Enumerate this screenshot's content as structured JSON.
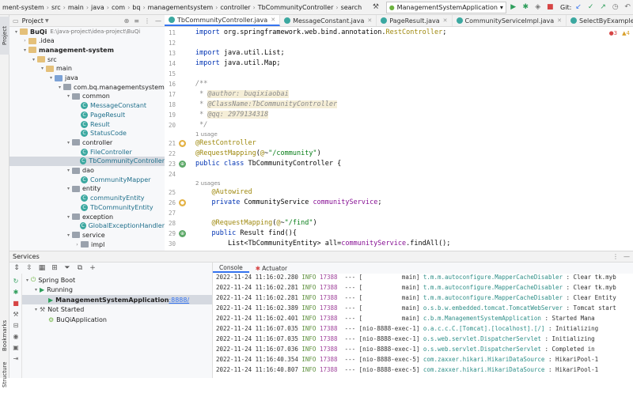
{
  "breadcrumb": [
    "ment-system",
    "src",
    "main",
    "java",
    "com",
    "bq",
    "managementsystem",
    "controller",
    "TbCommunityController",
    "search"
  ],
  "run_config": "ManagementSystemApplication",
  "git_label": "Git:",
  "project_panel": {
    "title": "Project"
  },
  "tree": [
    {
      "indent": 0,
      "arrow": "▾",
      "icon": "folder",
      "label": "BuQi",
      "path": "E:\\java-project\\idea-project\\BuQi",
      "bold": true
    },
    {
      "indent": 1,
      "arrow": "›",
      "icon": "folder",
      "label": ".idea"
    },
    {
      "indent": 1,
      "arrow": "▾",
      "icon": "folder",
      "label": "management-system",
      "bold": true
    },
    {
      "indent": 2,
      "arrow": "▾",
      "icon": "folder",
      "label": "src"
    },
    {
      "indent": 3,
      "arrow": "▾",
      "icon": "folder",
      "label": "main"
    },
    {
      "indent": 4,
      "arrow": "▾",
      "icon": "blue",
      "label": "java"
    },
    {
      "indent": 5,
      "arrow": "▾",
      "icon": "pkg",
      "label": "com.bq.managementsystem"
    },
    {
      "indent": 6,
      "arrow": "▾",
      "icon": "pkg",
      "label": "common"
    },
    {
      "indent": 7,
      "arrow": "",
      "icon": "class",
      "label": "MessageConstant"
    },
    {
      "indent": 7,
      "arrow": "",
      "icon": "class",
      "label": "PageResult"
    },
    {
      "indent": 7,
      "arrow": "",
      "icon": "class",
      "label": "Result"
    },
    {
      "indent": 7,
      "arrow": "",
      "icon": "class",
      "label": "StatusCode"
    },
    {
      "indent": 6,
      "arrow": "▾",
      "icon": "pkg",
      "label": "controller"
    },
    {
      "indent": 7,
      "arrow": "",
      "icon": "class",
      "label": "FileController"
    },
    {
      "indent": 7,
      "arrow": "",
      "icon": "class",
      "label": "TbCommunityController",
      "selected": true
    },
    {
      "indent": 6,
      "arrow": "▾",
      "icon": "pkg",
      "label": "dao"
    },
    {
      "indent": 7,
      "arrow": "",
      "icon": "class",
      "label": "CommunityMapper"
    },
    {
      "indent": 6,
      "arrow": "▾",
      "icon": "pkg",
      "label": "entity"
    },
    {
      "indent": 7,
      "arrow": "",
      "icon": "class",
      "label": "communityEntity"
    },
    {
      "indent": 7,
      "arrow": "",
      "icon": "class",
      "label": "TbCommunityEntity"
    },
    {
      "indent": 6,
      "arrow": "▾",
      "icon": "pkg",
      "label": "exception"
    },
    {
      "indent": 7,
      "arrow": "",
      "icon": "class",
      "label": "GlobalExceptionHandler"
    },
    {
      "indent": 6,
      "arrow": "▾",
      "icon": "pkg",
      "label": "service"
    },
    {
      "indent": 7,
      "arrow": "›",
      "icon": "pkg",
      "label": "impl"
    }
  ],
  "tabs": [
    {
      "label": "TbCommunityController.java",
      "active": true
    },
    {
      "label": "MessageConstant.java"
    },
    {
      "label": "PageResult.java"
    },
    {
      "label": "CommunityServiceImpl.java"
    },
    {
      "label": "SelectByExampleMapper.class"
    }
  ],
  "inspections": {
    "errors": "3",
    "warnings": "4"
  },
  "code": [
    {
      "ln": "11",
      "html": "<span class='kw'>import</span> org.springframework.web.bind.annotation.<span class='ann'>RestController</span>;"
    },
    {
      "ln": "12",
      "html": ""
    },
    {
      "ln": "13",
      "html": "<span class='kw'>import</span> java.util.List;"
    },
    {
      "ln": "14",
      "html": "<span class='kw'>import</span> java.util.Map;"
    },
    {
      "ln": "15",
      "html": ""
    },
    {
      "ln": "16",
      "html": "<span class='cmt'>/**</span>"
    },
    {
      "ln": "17",
      "html": "<span class='cmt'> * </span><span class='tag'>@author: buqixiaobai</span>"
    },
    {
      "ln": "18",
      "html": "<span class='cmt'> * </span><span class='tag'>@ClassName:TbCommunityController</span>"
    },
    {
      "ln": "19",
      "html": "<span class='cmt'> * </span><span class='tag'>@qq: 2979134318</span>"
    },
    {
      "ln": "20",
      "html": "<span class='cmt'> */</span>"
    },
    {
      "hint": "1 usage"
    },
    {
      "ln": "21",
      "html": "<span class='ann'>@RestController</span>",
      "gutter": "bean"
    },
    {
      "ln": "22",
      "html": "<span class='ann'>@RequestMapping</span>(<span class='ann'>@</span>~<span class='str'>\"/community\"</span>)"
    },
    {
      "ln": "23",
      "html": "<span class='kw'>public class</span> TbCommunityController {",
      "gutter": "web"
    },
    {
      "ln": "24",
      "html": ""
    },
    {
      "hint": "2 usages"
    },
    {
      "ln": "25",
      "html": "    <span class='ann'>@Autowired</span>"
    },
    {
      "ln": "26",
      "html": "    <span class='kw'>private</span> CommunityService <span class='fld'>communityService</span>;",
      "gutter": "bean"
    },
    {
      "ln": "27",
      "html": ""
    },
    {
      "ln": "28",
      "html": "    <span class='ann'>@RequestMapping</span>(<span class='ann'>@</span>~<span class='str'>\"/find\"</span>)"
    },
    {
      "ln": "29",
      "html": "    <span class='kw'>public</span> Result find(){",
      "gutter": "web"
    },
    {
      "ln": "30",
      "html": "        List&lt;TbCommunityEntity&gt; all=<span class='fld'>communityService</span>.findAll();"
    }
  ],
  "services": {
    "title": "Services",
    "tree": [
      {
        "indent": 0,
        "arrow": "▾",
        "label": "Spring Boot",
        "icon": "spring"
      },
      {
        "indent": 1,
        "arrow": "▾",
        "label": "Running",
        "icon": "run"
      },
      {
        "indent": 2,
        "arrow": "",
        "label": "ManagementSystemApplication",
        "port": ":8888/",
        "icon": "run",
        "selected": true,
        "bold": true
      },
      {
        "indent": 1,
        "arrow": "▾",
        "label": "Not Started",
        "icon": "wrench"
      },
      {
        "indent": 2,
        "arrow": "",
        "label": "BuQiApplication",
        "icon": "app"
      }
    ],
    "console_tabs": [
      "Console",
      "Actuator"
    ]
  },
  "log": [
    {
      "ts": "2022-11-24 11:16:02.280",
      "lvl": "INFO",
      "pid": "17388",
      "thr": "[           main]",
      "logger": "t.m.m.autoconfigure.MapperCacheDisabler",
      "msg": ": Clear tk.myb"
    },
    {
      "ts": "2022-11-24 11:16:02.281",
      "lvl": "INFO",
      "pid": "17388",
      "thr": "[           main]",
      "logger": "t.m.m.autoconfigure.MapperCacheDisabler",
      "msg": ": Clear tk.myb"
    },
    {
      "ts": "2022-11-24 11:16:02.281",
      "lvl": "INFO",
      "pid": "17388",
      "thr": "[           main]",
      "logger": "t.m.m.autoconfigure.MapperCacheDisabler",
      "msg": ": Clear Entity"
    },
    {
      "ts": "2022-11-24 11:16:02.389",
      "lvl": "INFO",
      "pid": "17388",
      "thr": "[           main]",
      "logger": "o.s.b.w.embedded.tomcat.TomcatWebServer",
      "msg": ": Tomcat start"
    },
    {
      "ts": "2022-11-24 11:16:02.401",
      "lvl": "INFO",
      "pid": "17388",
      "thr": "[           main]",
      "logger": "c.b.m.ManagementSystemApplication",
      "msg": ": Started Mana"
    },
    {
      "ts": "2022-11-24 11:16:07.035",
      "lvl": "INFO",
      "pid": "17388",
      "thr": "[nio-8888-exec-1]",
      "logger": "o.a.c.c.C.[Tomcat].[localhost].[/]",
      "msg": ": Initializing"
    },
    {
      "ts": "2022-11-24 11:16:07.035",
      "lvl": "INFO",
      "pid": "17388",
      "thr": "[nio-8888-exec-1]",
      "logger": "o.s.web.servlet.DispatcherServlet",
      "msg": ": Initializing"
    },
    {
      "ts": "2022-11-24 11:16:07.036",
      "lvl": "INFO",
      "pid": "17388",
      "thr": "[nio-8888-exec-1]",
      "logger": "o.s.web.servlet.DispatcherServlet",
      "msg": ": Completed in"
    },
    {
      "ts": "2022-11-24 11:16:40.354",
      "lvl": "INFO",
      "pid": "17388",
      "thr": "[nio-8888-exec-5]",
      "logger": "com.zaxxer.hikari.HikariDataSource",
      "msg": ": HikariPool-1"
    },
    {
      "ts": "2022-11-24 11:16:40.807",
      "lvl": "INFO",
      "pid": "17388",
      "thr": "[nio-8888-exec-5]",
      "logger": "com.zaxxer.hikari.HikariDataSource",
      "msg": ": HikariPool-1"
    }
  ],
  "side_tabs": {
    "project": "Project",
    "bookmarks": "Bookmarks",
    "structure": "Structure"
  }
}
